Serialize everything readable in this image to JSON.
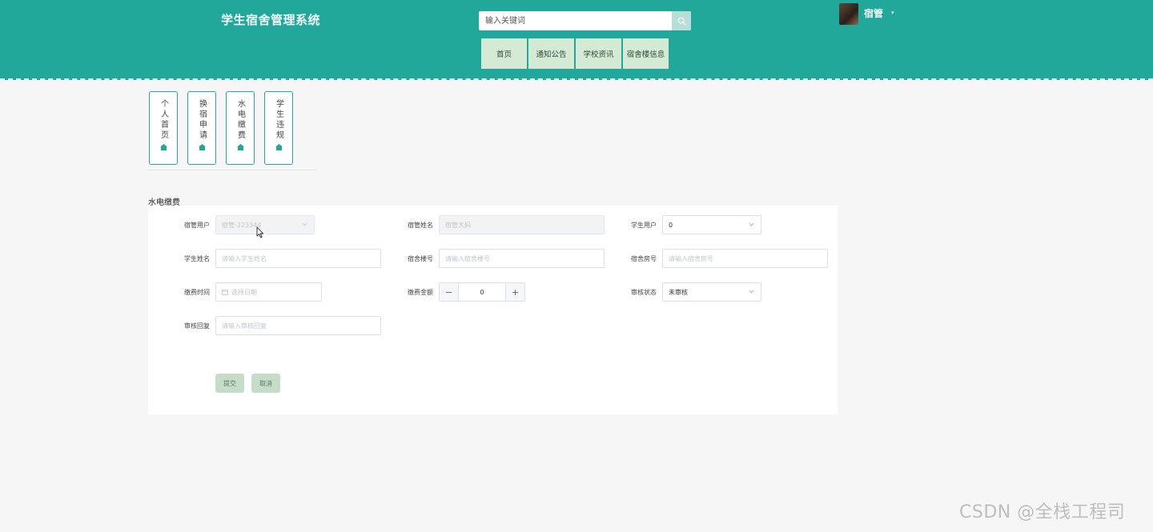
{
  "header": {
    "app_title": "学生宿舍管理系统",
    "search": {
      "placeholder": "输入关键词",
      "value": ""
    },
    "nav": [
      "首页",
      "通知公告",
      "学校资讯",
      "宿舍楼信息"
    ],
    "user": {
      "name": "宿管",
      "caret": "▾"
    }
  },
  "side_menu": [
    "个人首页",
    "换宿申请",
    "水电缴费",
    "学生违规"
  ],
  "section_title": "水电缴费",
  "form": {
    "dorm_user": {
      "label": "宿管用户",
      "value": "宿管-223344"
    },
    "dorm_name": {
      "label": "宿管姓名",
      "value": "宿管大妈"
    },
    "student_user": {
      "label": "学生用户",
      "value": "0"
    },
    "student_name": {
      "label": "学生姓名",
      "placeholder": "请输入学生姓名"
    },
    "building_no": {
      "label": "宿舍楼号",
      "placeholder": "请输入宿舍楼号"
    },
    "room_no": {
      "label": "宿舍房号",
      "placeholder": "请输入宿舍房号"
    },
    "pay_time": {
      "label": "缴费时间",
      "placeholder": "选择日期"
    },
    "pay_amount": {
      "label": "缴费金额",
      "value": "0",
      "minus": "−",
      "plus": "+"
    },
    "review_status": {
      "label": "审核状态",
      "value": "未审核"
    },
    "review_reply": {
      "label": "审核回复",
      "placeholder": "请输入审核回复"
    },
    "submit_label": "提交",
    "cancel_label": "取消"
  },
  "watermark": "CSDN @全栈工程司",
  "colors": {
    "header_bg": "#21a89b",
    "nav_bg": "#d5ead4",
    "button_bg": "#c5dcc8"
  }
}
